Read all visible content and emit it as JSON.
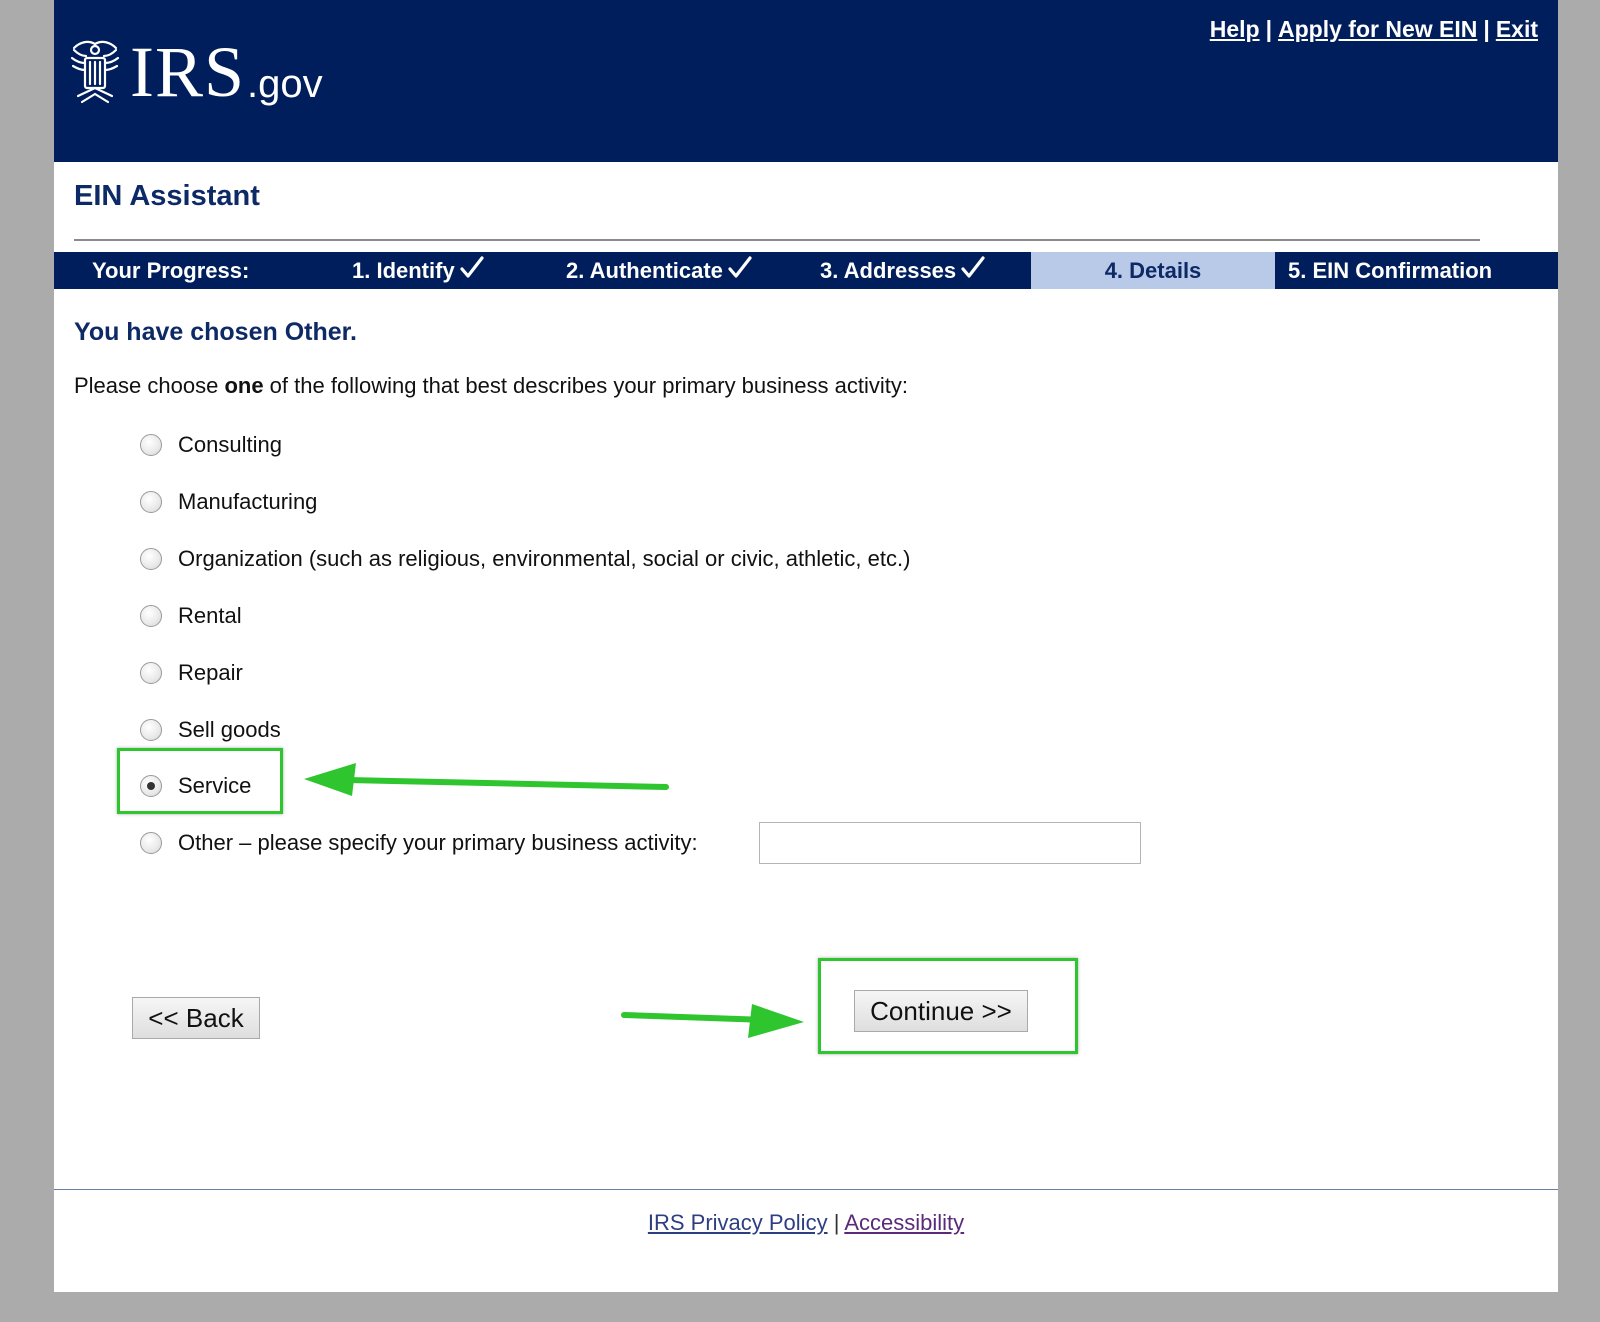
{
  "header": {
    "logo_irs": "IRS",
    "logo_gov": ".gov",
    "links": {
      "help": "Help",
      "apply": "Apply for New EIN",
      "exit": "Exit",
      "separator": "|"
    }
  },
  "app_title": "EIN Assistant",
  "progress": {
    "label": "Your Progress:",
    "steps": [
      {
        "label": "1. Identify",
        "completed": true
      },
      {
        "label": "2. Authenticate",
        "completed": true
      },
      {
        "label": "3. Addresses",
        "completed": true
      },
      {
        "label": "4. Details",
        "current": true
      },
      {
        "label": "5. EIN Confirmation"
      }
    ]
  },
  "content": {
    "heading": "You have chosen Other.",
    "instruction_pre": "Please choose ",
    "instruction_bold": "one",
    "instruction_post": " of the following that best describes your primary business activity:",
    "options": [
      {
        "label": "Consulting",
        "checked": false
      },
      {
        "label": "Manufacturing",
        "checked": false
      },
      {
        "label": "Organization (such as religious, environmental, social or civic, athletic, etc.)",
        "checked": false
      },
      {
        "label": "Rental",
        "checked": false
      },
      {
        "label": "Repair",
        "checked": false
      },
      {
        "label": "Sell goods",
        "checked": false
      },
      {
        "label": "Service",
        "checked": true
      },
      {
        "label": "Other – please specify your primary business activity:",
        "checked": false
      }
    ],
    "other_value": ""
  },
  "buttons": {
    "back": "<< Back",
    "continue": "Continue >>"
  },
  "annotations": {
    "color": "#2ec52e"
  },
  "footer": {
    "privacy": "IRS Privacy Policy",
    "separator": "|",
    "accessibility": "Accessibility"
  },
  "colors": {
    "header_bg": "#001e5b",
    "current_step_bg": "#b9c9e8",
    "page_bg": "#ababab"
  }
}
